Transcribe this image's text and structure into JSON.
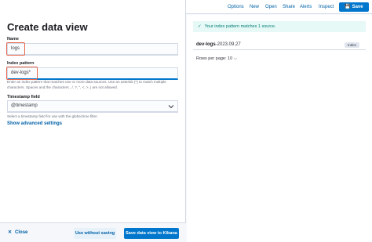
{
  "flyout": {
    "title": "Create data view",
    "name_label": "Name",
    "name_value": "logs",
    "pattern_label": "Index pattern",
    "pattern_value": "dev-logs*",
    "pattern_help": "Enter an index pattern that matches one or more data sources. Use an asterisk (*) to match multiple characters. Spaces and the characters , /, ?, \", <, >, | are not allowed.",
    "timestamp_label": "Timestamp field",
    "timestamp_value": "@timestamp",
    "timestamp_help": "Select a timestamp field for use with the global time filter.",
    "advanced_link": "Show advanced settings",
    "close_label": "Close",
    "without_saving_label": "Use without saving",
    "save_to_kibana_label": "Save data view to Kibana"
  },
  "topnav": {
    "options": "Options",
    "new": "New",
    "open": "Open",
    "share": "Share",
    "alerts": "Alerts",
    "inspect": "Inspect",
    "save": "Save"
  },
  "results": {
    "callout": "Your index pattern matches 1 source.",
    "source_bold": "dev-logs",
    "source_rest": "-2023.09.27",
    "source_type": "Index",
    "rows_per_page": "Rows per page: 10"
  },
  "colors": {
    "accent": "#0077cc",
    "highlight": "#e7664c",
    "success": "#017d73"
  }
}
